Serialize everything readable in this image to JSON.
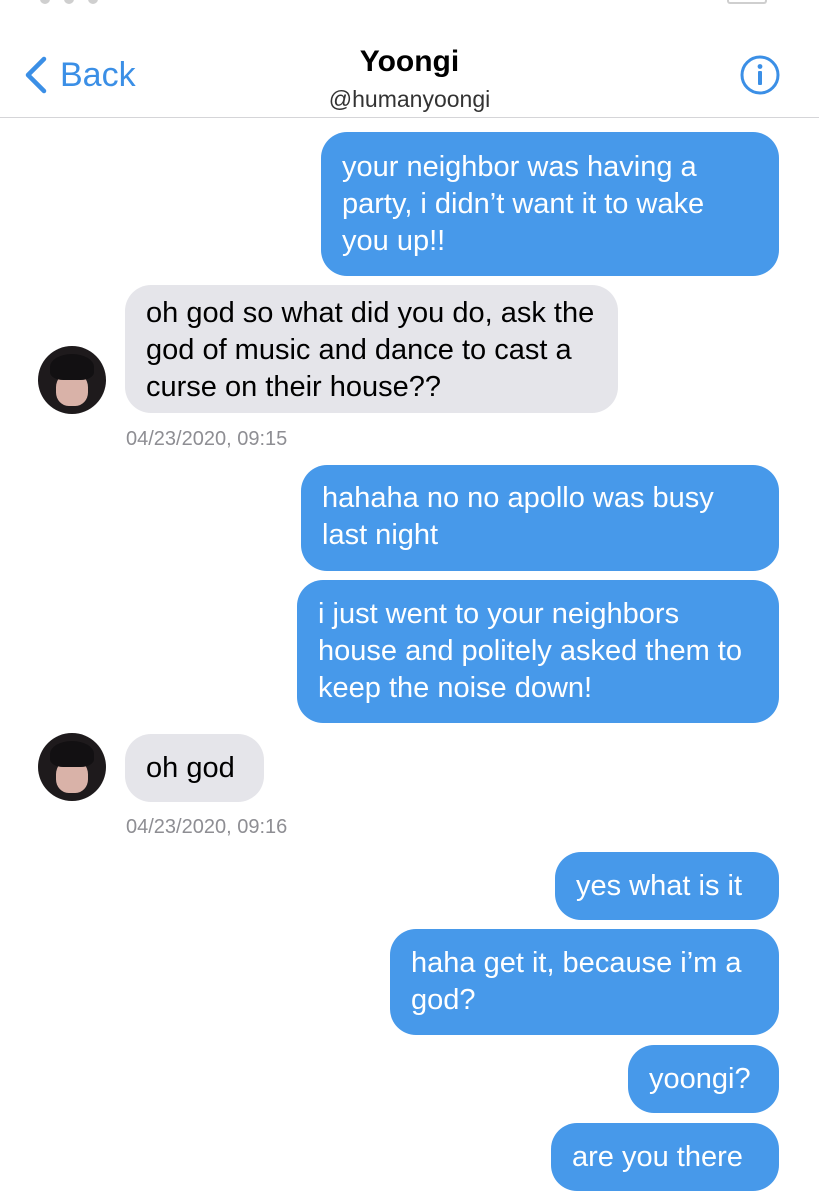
{
  "header": {
    "back_label": "Back",
    "contact_name": "Yoongi",
    "contact_handle": "@humanyoongi",
    "info_icon": "info-circle-icon"
  },
  "colors": {
    "accent": "#3b8fe6",
    "outgoing_bubble": "#4799ea",
    "incoming_bubble": "#e5e5ea",
    "timestamp": "#8e8e93"
  },
  "messages": [
    {
      "direction": "outgoing",
      "text": "your neighbor was having a party, i didn’t want it to wake you up!!"
    },
    {
      "direction": "incoming",
      "text": "oh god so what did you do, ask the god of music and dance to cast a curse on their house??"
    },
    {
      "direction": "outgoing",
      "text": "hahaha no no apollo was busy last night"
    },
    {
      "direction": "outgoing",
      "text": "i just went to your neighbors house and politely asked them to keep the noise down!"
    },
    {
      "direction": "incoming",
      "text": "oh god"
    },
    {
      "direction": "outgoing",
      "text": "yes what is it"
    },
    {
      "direction": "outgoing",
      "text": "haha get it, because i’m a god?"
    },
    {
      "direction": "outgoing",
      "text": "yoongi?"
    },
    {
      "direction": "outgoing",
      "text": "are you there"
    }
  ],
  "timestamps": [
    "04/23/2020, 09:15",
    "04/23/2020, 09:16"
  ]
}
